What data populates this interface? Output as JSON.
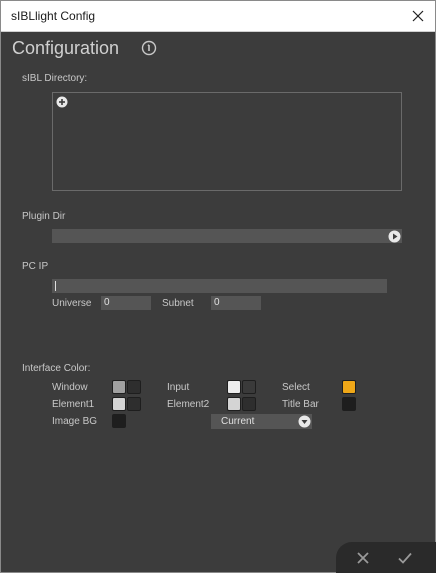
{
  "window": {
    "title": "sIBLlight Config"
  },
  "heading": {
    "title": "Configuration"
  },
  "icons": {
    "close": "close-icon",
    "info": "info-icon",
    "add": "plus-circle-icon",
    "browse": "play-circle-icon",
    "dropdown": "chevron-down-circle-icon",
    "cancel": "x-icon",
    "confirm": "checkmark-icon"
  },
  "sibl_directory": {
    "label": "sIBL Directory:"
  },
  "plugin_dir": {
    "label": "Plugin Dir",
    "value": ""
  },
  "pc_ip": {
    "label": "PC IP",
    "value": "",
    "universe_label": "Universe",
    "universe_value": "0",
    "subnet_label": "Subnet",
    "subnet_value": "0"
  },
  "interface_color": {
    "label": "Interface Color:",
    "window_label": "Window",
    "input_label": "Input",
    "select_label": "Select",
    "element1_label": "Element1",
    "element2_label": "Element2",
    "titlebar_label": "Title Bar",
    "imagebg_label": "Image BG",
    "preset_value": "Current",
    "colors": {
      "window_a": "#a0a0a0",
      "window_b": "#2e2e2e",
      "input_a": "#ececec",
      "input_b": "#3a3a3a",
      "select": "#f0a818",
      "element1_a": "#d4d4d4",
      "element1_b": "#2e2e2e",
      "element2_a": "#d4d4d4",
      "element2_b": "#2e2e2e",
      "titlebar": "#1e1e1e",
      "imagebg": "#1e1e1e"
    }
  }
}
